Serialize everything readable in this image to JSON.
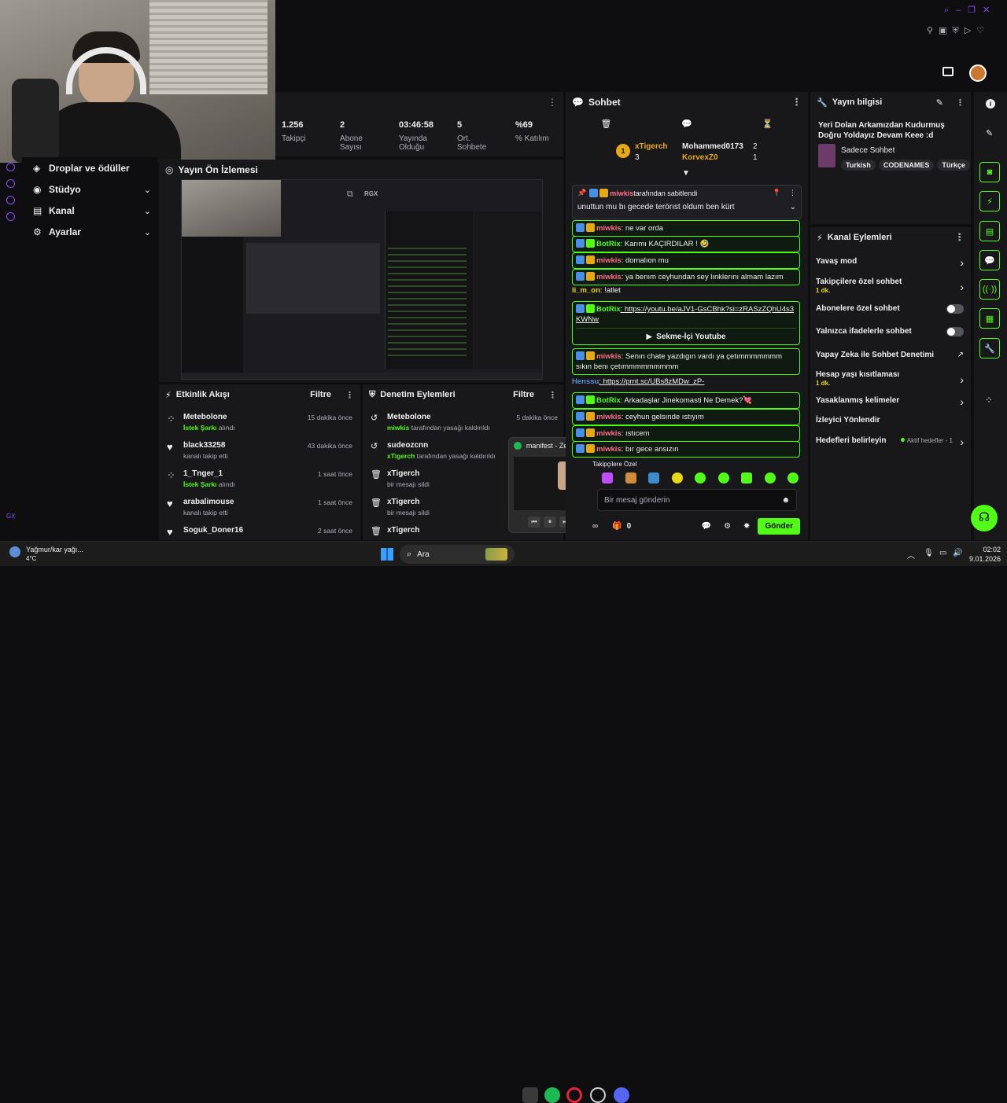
{
  "stats": [
    {
      "value": "1.256",
      "label": "Takipçi"
    },
    {
      "value": "2",
      "label": "Abone Sayısı"
    },
    {
      "value": "03:46:58",
      "label": "Yayında Olduğu"
    },
    {
      "value": "5",
      "label": "Ort. Sohbete"
    },
    {
      "value": "%69",
      "label": "% Katılım"
    }
  ],
  "sidebar": {
    "items": [
      {
        "label": "Droplar ve ödüller"
      },
      {
        "label": "Stüdyo"
      },
      {
        "label": "Kanal"
      },
      {
        "label": "Ayarlar"
      }
    ],
    "bottom_label": "GX"
  },
  "preview": {
    "title": "Yayın Ön İzlemesi",
    "rgx": "RGX"
  },
  "activity": {
    "title": "Etkinlik Akışı",
    "filter": "Filtre",
    "items": [
      {
        "name": "Metebolone",
        "time": "15 dakika önce",
        "hl": "İstek Şarkı",
        "rest": " alındı"
      },
      {
        "name": "black33258",
        "time": "43 dakika önce",
        "hl": "",
        "rest": "kanalı takip etti"
      },
      {
        "name": "1_Tnger_1",
        "time": "1 saat önce",
        "hl": "İstek Şarkı",
        "rest": " alındı"
      },
      {
        "name": "arabalimouse",
        "time": "1 saat önce",
        "hl": "",
        "rest": "kanalı takip etti"
      },
      {
        "name": "Soguk_Doner16",
        "time": "2 saat önce",
        "hl": "",
        "rest": ""
      }
    ]
  },
  "moderation": {
    "title": "Denetim Eylemleri",
    "filter": "Filtre",
    "items": [
      {
        "name": "Metebolone",
        "time": "5 dakika önce",
        "hl": "miwkis",
        "rest": " tarafından yasağı kaldırıldı"
      },
      {
        "name": "sudeozcnn",
        "time": "",
        "hl": "xTigerch",
        "rest": " tarafından yasağı kaldırıldı"
      },
      {
        "name": "xTigerch",
        "time": "",
        "hl": "",
        "rest": "bir mesajı sildi"
      },
      {
        "name": "xTigerch",
        "time": "",
        "hl": "",
        "rest": "bir mesajı sildi"
      },
      {
        "name": "xTigerch",
        "time": "",
        "hl": "",
        "rest": ""
      }
    ]
  },
  "spotify_popup": {
    "title": "manifest - Zehir -..."
  },
  "chat": {
    "title": "Sohbet",
    "leaders": [
      {
        "rank": "1",
        "name": "xTigerch",
        "count": "3"
      },
      {
        "name": "Mohammed0173",
        "count": "2"
      },
      {
        "name": "KorvexZ0",
        "count": "1"
      }
    ],
    "pinned": {
      "user": "miwkis",
      "by": " tarafından sabitlendi",
      "text": "unuttun mu bı gecede terörıst oldum ben kürt"
    },
    "messages": [
      {
        "user": "miwkis",
        "text": ": ne var orda",
        "box": true
      },
      {
        "user": "BotRix",
        "text": ": Karımı KAÇIRDILAR ! 🤣",
        "box": true
      },
      {
        "user": "miwkis",
        "text": ": domalıon mu",
        "box": true
      },
      {
        "user": "miwkis",
        "text": ": ya benım ceyhundan sey lınklerını almam lazım",
        "box": true
      },
      {
        "user": "li_m_on",
        "text": ": !atlet",
        "box": false
      },
      {
        "user": "BotRix",
        "text": ": https://youtu.be/aJV1-GsCBhk?si=zRASzZQhU4s3KWNw",
        "box": true
      },
      {
        "user": "miwkis",
        "text": ": Senın chate yazdıgın vardı ya çetımmmmmmm sıkın benı çetımmmmmmmmm",
        "box": true
      },
      {
        "user": "Henssu",
        "text": ": https://prnt.sc/UBs8zMDw_zP-",
        "box": false
      },
      {
        "user": "BotRix",
        "text": ": Arkadaşlar Jinekomasti Ne Demek?💘",
        "box": true
      },
      {
        "user": "miwkis",
        "text": ": ceyhun gelsınde ıstıyım",
        "box": true
      },
      {
        "user": "miwkis",
        "text": ": ıstıcem",
        "box": true
      },
      {
        "user": "miwkis",
        "text": ": bır gece ansızın",
        "box": true
      }
    ],
    "youtube_label": "Sekme-İçi Youtube",
    "emote_section": "Takipçilere Özel",
    "input_placeholder": "Bir mesaj gönderin",
    "count": "0",
    "send": "Gönder"
  },
  "stream_info": {
    "title": "Yayın bilgisi",
    "stream_title": "Yeri Dolan Arkamızdan Kudurmuş Doğru Yoldayız Devam Keee :d",
    "category": "Sadece Sohbet",
    "tags": [
      "Turkish",
      "CODENAMES",
      "Türkçe"
    ]
  },
  "channel_actions": {
    "title": "Kanal Eylemleri",
    "items": [
      {
        "label": "Yavaş mod",
        "sub": "",
        "ctrl": "chevron"
      },
      {
        "label": "Takipçilere özel sohbet",
        "sub": "1 dk.",
        "ctrl": "chevron"
      },
      {
        "label": "Abonelere özel sohbet",
        "sub": "",
        "ctrl": "toggle"
      },
      {
        "label": "Yalnızca ifadelerle sohbet",
        "sub": "",
        "ctrl": "toggle"
      },
      {
        "label": "Yapay Zeka ile Sohbet Denetimi",
        "sub": "",
        "ctrl": "external"
      },
      {
        "label": "Hesap yaşı kısıtlaması",
        "sub": "1 dk.",
        "ctrl": "chevron"
      },
      {
        "label": "Yasaklanmış kelimeler",
        "sub": "",
        "ctrl": "chevron"
      },
      {
        "label": "İzleyici Yönlendir",
        "sub": "",
        "ctrl": ""
      },
      {
        "label": "Hedefleri belirleyin",
        "sub": "",
        "ctrl": "chevron",
        "extra": "Aktif hedefler - 1"
      }
    ]
  },
  "taskbar": {
    "weather_title": "Yağmur/kar yağı...",
    "weather_temp": "4°C",
    "search": "Ara",
    "time": "02:02",
    "date": "9.01.2026"
  }
}
